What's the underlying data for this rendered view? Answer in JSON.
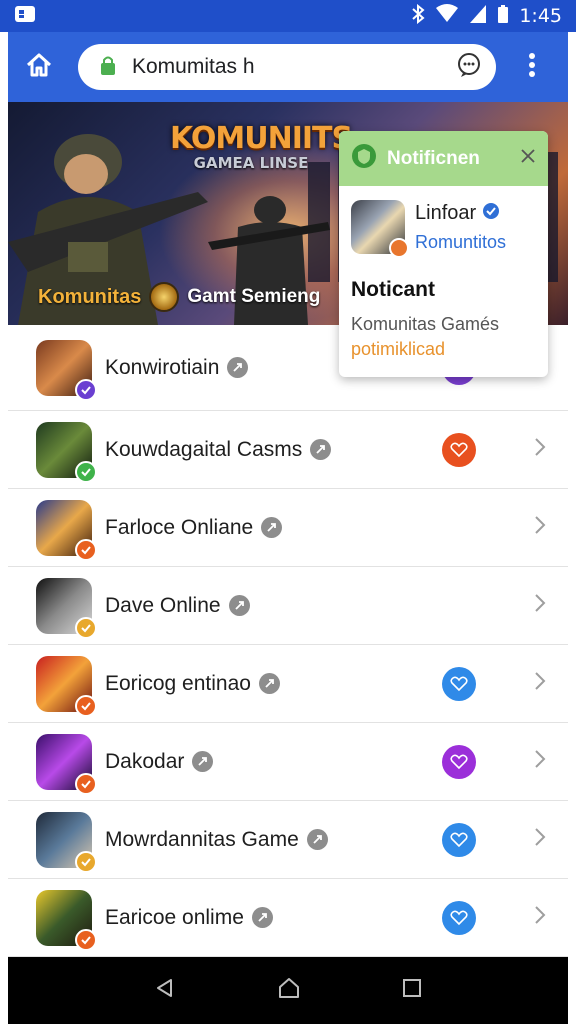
{
  "status_bar": {
    "time": "1:45"
  },
  "toolbar": {
    "url_text": "Komumitas h"
  },
  "hero": {
    "title": "KOMUNIITS",
    "subtitle": "GAMEA LINSE",
    "brand": "Komunitas",
    "tagline": "Gamt Semieng"
  },
  "notification": {
    "title": "Notificnen",
    "app_name": "Linfoar",
    "app_subtitle": "Romuntitos",
    "heading": "Noticant",
    "body": "Komunitas Gamés",
    "link": "potimiklicad"
  },
  "games": [
    {
      "name": "Konwirotiain",
      "verify_color": "#6a3fd1",
      "icon_colors": [
        "#7a3a1f",
        "#d98a4a",
        "#3a1a10"
      ],
      "heart": "#7a3fd1"
    },
    {
      "name": "Kouwdagaital Casms",
      "verify_color": "#3fb34a",
      "icon_colors": [
        "#1f3a1f",
        "#6a8a3a",
        "#0f1a0f"
      ],
      "heart": "#e8501f"
    },
    {
      "name": "Farloce Onliane",
      "verify_color": "#e8601f",
      "icon_colors": [
        "#2a3a8a",
        "#e8a84a",
        "#3a1a0a"
      ],
      "heart": null
    },
    {
      "name": "Dave Online",
      "verify_color": "#e8a82d",
      "icon_colors": [
        "#0f0f0f",
        "#8a8a8a",
        "#d9d9d9"
      ],
      "heart": null
    },
    {
      "name": "Eoricog entinao",
      "verify_color": "#e8601f",
      "icon_colors": [
        "#c81f1f",
        "#f3a23a",
        "#6a0f0f"
      ],
      "heart": "#2f8ae8"
    },
    {
      "name": "Dakodar",
      "verify_color": "#e8601f",
      "icon_colors": [
        "#3a0f6a",
        "#b84ae8",
        "#0f0a2a"
      ],
      "heart": "#9b2fd9"
    },
    {
      "name": "Mowrdannitas Game",
      "verify_color": "#e8a82d",
      "icon_colors": [
        "#1f2a3a",
        "#5a7a9a",
        "#d9c8b0"
      ],
      "heart": "#2f8ae8"
    },
    {
      "name": "Earicoe onlime",
      "verify_color": "#e8601f",
      "icon_colors": [
        "#e8c82d",
        "#3a5a2a",
        "#1f1a0f"
      ],
      "heart": "#2f8ae8"
    }
  ],
  "icons": {
    "home": "home-icon",
    "lock": "lock-icon",
    "chat": "chat-bubble-icon",
    "menu": "overflow-menu-icon",
    "back": "back-triangle-icon",
    "nav_home": "home-circle-icon",
    "recents": "recents-square-icon"
  },
  "colors": {
    "status_bar": "#1f4fc9",
    "toolbar": "#2f63d9",
    "notification_header": "#a6d98c",
    "link_blue": "#2f6fd6",
    "link_orange": "#e8922d"
  }
}
